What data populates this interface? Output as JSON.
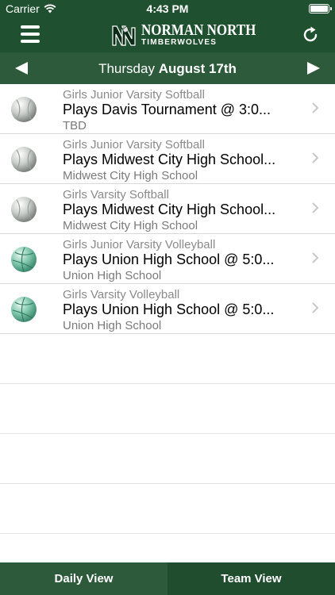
{
  "status_bar": {
    "carrier": "Carrier",
    "time": "4:43 PM"
  },
  "header": {
    "logo_line1": "NORMAN NORTH",
    "logo_line2": "TIMBERWOLVES",
    "logo_initials": "NN",
    "menu_icon": "hamburger-menu-icon",
    "refresh_icon": "refresh-icon"
  },
  "date_bar": {
    "weekday": "Thursday",
    "date": "August 17th",
    "prev_icon": "left-arrow-icon",
    "next_icon": "right-arrow-icon"
  },
  "events": [
    {
      "team": "Girls Junior Varsity Softball",
      "title": "Plays Davis Tournament @ 3:0...",
      "venue": "TBD",
      "sport": "softball"
    },
    {
      "team": "Girls Junior Varsity Softball",
      "title": "Plays Midwest City High School...",
      "venue": "Midwest City High School",
      "sport": "softball"
    },
    {
      "team": "Girls Varsity Softball",
      "title": "Plays Midwest City High School...",
      "venue": "Midwest City High School",
      "sport": "softball"
    },
    {
      "team": "Girls Junior Varsity Volleyball",
      "title": "Plays Union High School @ 5:0...",
      "venue": "Union High School",
      "sport": "volleyball"
    },
    {
      "team": "Girls Varsity Volleyball",
      "title": "Plays Union High School @ 5:0...",
      "venue": "Union High School",
      "sport": "volleyball"
    }
  ],
  "tabs": [
    {
      "label": "Daily View",
      "active": true
    },
    {
      "label": "Team View",
      "active": false
    }
  ],
  "colors": {
    "nav_green": "#1f5130",
    "date_bar_green": "#2c5a3a",
    "tab_active": "#2c5a3a",
    "tab_inactive": "#1f4d2e"
  }
}
